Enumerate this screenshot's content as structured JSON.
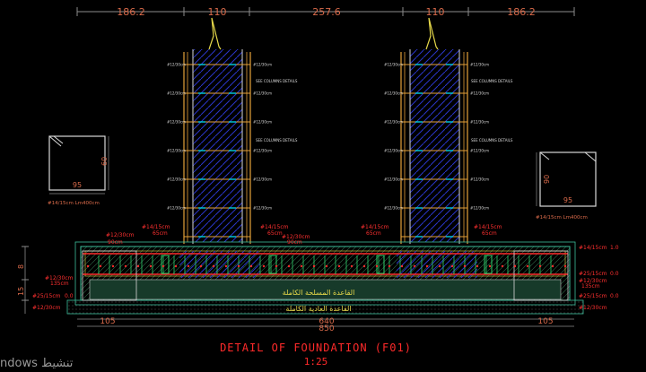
{
  "dimensions_top": [
    "186.2",
    "110",
    "257.6",
    "110",
    "186.2"
  ],
  "dimensions_bottom": {
    "left_span": "105",
    "mid_inner": "640",
    "mid_outer": "850",
    "right_span": "105"
  },
  "left_side_dims": [
    "8",
    "15"
  ],
  "column_bar_label": "#12/30cm",
  "see_column_details": "SEE COLUMNS DETAILS",
  "tie_beam": {
    "dim_a": "60",
    "dim_b": "95",
    "caption": "#14/15cm  Lm400cm"
  },
  "tie_beam_right": {
    "dim_a": "90",
    "dim_b": "95",
    "caption": "#14/15cm  Lm400cm"
  },
  "labels_red": {
    "col_left_top": "#14/15cm",
    "col_left_len": "65cm",
    "col_right_top": "#14/15cm",
    "col_right_len": "65cm",
    "mid_l_top": "#14/15cm",
    "mid_l_len": "65cm",
    "mid_r_top": "#14/15cm",
    "mid_r_len": "65cm",
    "stirrup_a": "#12/30cm",
    "stirrup_a_len": "90cm",
    "stirrup_b": "#12/30cm",
    "stirrup_b_len": "90cm",
    "left_a": "#12/30cm",
    "left_a_len": "135cm",
    "left_b": "#25/15cm",
    "left_b_len": "0.0",
    "left_c": "#12/30cm",
    "right_a": "#14/15cm",
    "right_a_len": "1.0",
    "right_b": "#25/15cm",
    "right_b_len": "0.0",
    "right_c": "#12/30cm",
    "right_c_len": "135cm",
    "right_d": "#25/15cm",
    "right_d_len": "0.0",
    "right_e": "#12/30cm"
  },
  "arabic_labels": [
    "القاعدة المسلحة الكاملة",
    "القاعدة العادية الكاملة"
  ],
  "title": "DETAIL OF FOUNDATION (F01)",
  "scale": "1:25",
  "watermark": "ndows تنشيط"
}
